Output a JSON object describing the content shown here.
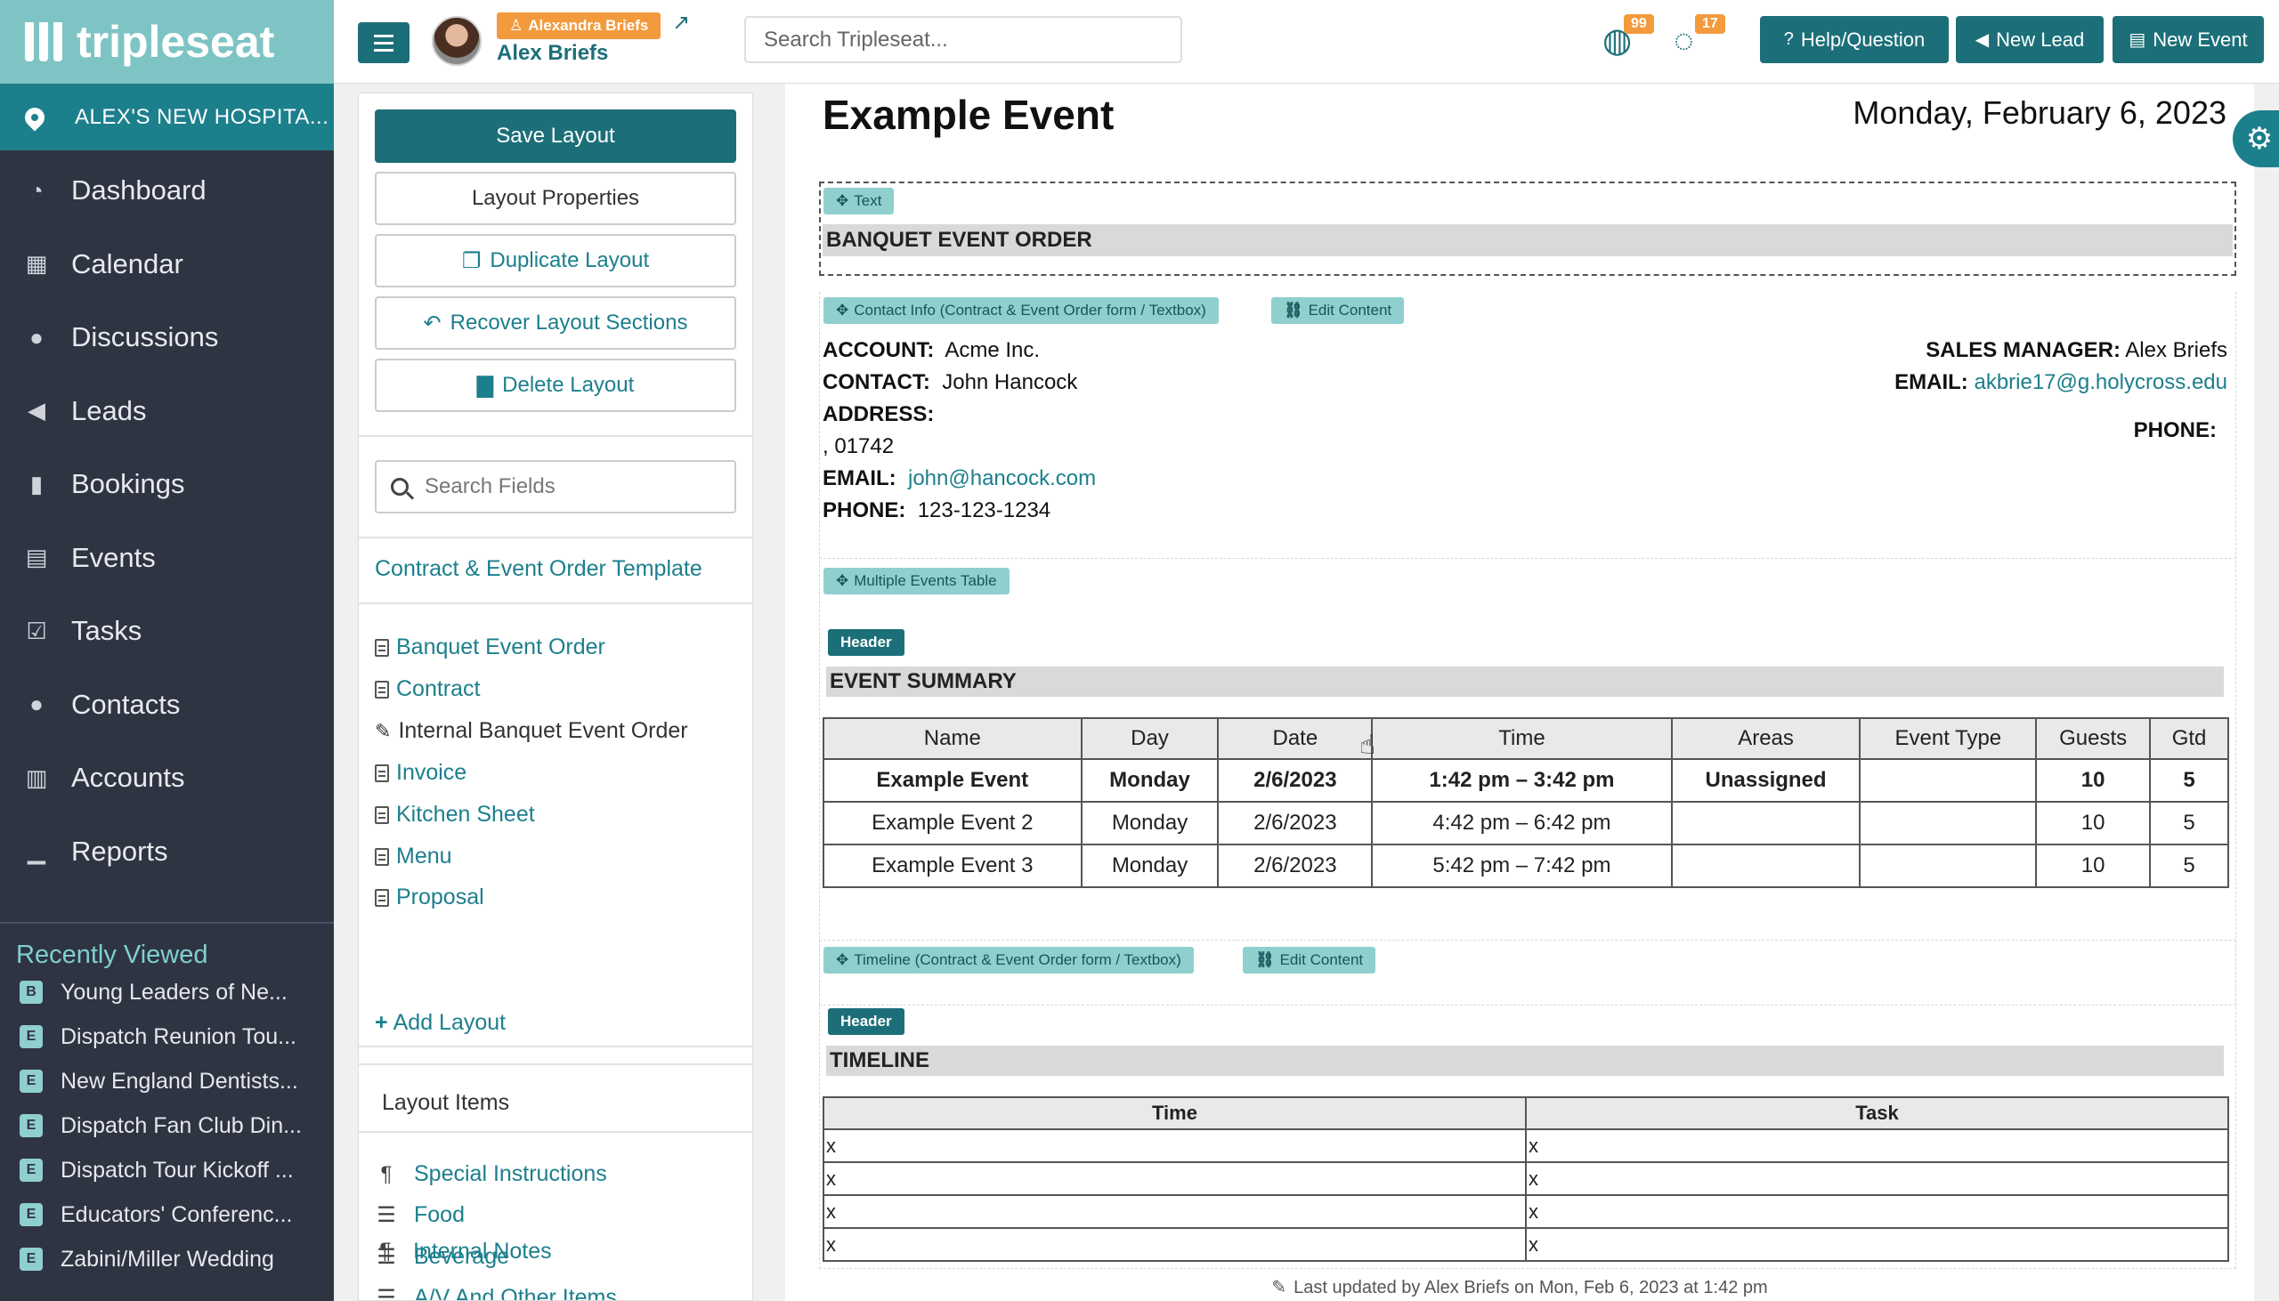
{
  "sidebar": {
    "logo_text": "tripleseat",
    "venue": "ALEX'S NEW HOSPITA...",
    "nav": [
      {
        "label": "Dashboard",
        "icon": "dashboard-icon"
      },
      {
        "label": "Calendar",
        "icon": "calendar-icon"
      },
      {
        "label": "Discussions",
        "icon": "chat-icon"
      },
      {
        "label": "Leads",
        "icon": "megaphone-icon"
      },
      {
        "label": "Bookings",
        "icon": "bookmark-icon"
      },
      {
        "label": "Events",
        "icon": "list-icon"
      },
      {
        "label": "Tasks",
        "icon": "checkbox-icon"
      },
      {
        "label": "Contacts",
        "icon": "users-icon"
      },
      {
        "label": "Accounts",
        "icon": "building-icon"
      },
      {
        "label": "Reports",
        "icon": "bar-chart-icon"
      }
    ],
    "recent_title": "Recently Viewed",
    "recent": [
      {
        "badge": "B",
        "label": "Young Leaders of Ne..."
      },
      {
        "badge": "E",
        "label": "Dispatch Reunion Tou..."
      },
      {
        "badge": "E",
        "label": "New England Dentists..."
      },
      {
        "badge": "E",
        "label": "Dispatch Fan Club Din..."
      },
      {
        "badge": "E",
        "label": "Dispatch Tour Kickoff ..."
      },
      {
        "badge": "E",
        "label": "Educators' Conferenc..."
      },
      {
        "badge": "E",
        "label": "Zabini/Miller Wedding"
      }
    ]
  },
  "topbar": {
    "impersonating": "Alexandra Briefs",
    "user_name": "Alex Briefs",
    "search_placeholder": "Search Tripleseat...",
    "globe_count": "99",
    "chat_count": "17",
    "help_label": "Help/Question",
    "new_lead_label": "New Lead",
    "new_event_label": "New Event"
  },
  "panel": {
    "save_layout": "Save Layout",
    "layout_properties": "Layout Properties",
    "duplicate_layout": "Duplicate Layout",
    "recover_sections": "Recover Layout Sections",
    "delete_layout": "Delete Layout",
    "search_fields_placeholder": "Search Fields",
    "template": "Contract & Event Order Template",
    "layouts": [
      {
        "label": "Banquet Event Order",
        "active": false
      },
      {
        "label": "Contract",
        "active": false
      },
      {
        "label": "Internal Banquet Event Order",
        "active": true
      },
      {
        "label": "Invoice",
        "active": false
      },
      {
        "label": "Kitchen Sheet",
        "active": false
      },
      {
        "label": "Menu",
        "active": false
      },
      {
        "label": "Proposal",
        "active": false
      }
    ],
    "add_layout": "Add Layout",
    "layout_items_title": "Layout Items",
    "layout_items": [
      {
        "label": "Special Instructions",
        "icon": "paragraph-icon"
      },
      {
        "label": "Food",
        "icon": "list-icon"
      },
      {
        "label": "Beverage",
        "icon": "list-icon"
      },
      {
        "label": "A/V And Other Items",
        "icon": "list-icon"
      },
      {
        "label": "Internal Notes",
        "icon": "paragraph-icon"
      }
    ]
  },
  "document": {
    "title": "Example Event",
    "date": "Monday, February 6, 2023",
    "text_tag": "Text",
    "banquet_header": "BANQUET EVENT ORDER",
    "contact_tag": "Contact Info (Contract & Event Order form / Textbox)",
    "edit_content": "Edit Content",
    "contact": {
      "account_label": "ACCOUNT:",
      "account": "Acme Inc.",
      "contact_label": "CONTACT:",
      "contact": "John Hancock",
      "address_label": "ADDRESS:",
      "address_line": ", 01742",
      "email_label": "EMAIL:",
      "email": "john@hancock.com",
      "phone_label": "PHONE:",
      "phone": "123-123-1234",
      "sales_manager_label": "SALES MANAGER:",
      "sales_manager": "Alex Briefs",
      "sm_email_label": "EMAIL:",
      "sm_email": "akbrie17@g.holycross.edu",
      "sm_phone_label": "PHONE:"
    },
    "multi_tag": "Multiple Events Table",
    "header_tag": "Header",
    "summary_header": "EVENT SUMMARY",
    "events_table": {
      "columns": [
        "Name",
        "Day",
        "Date",
        "Time",
        "Areas",
        "Event Type",
        "Guests",
        "Gtd"
      ],
      "rows": [
        [
          "Example Event",
          "Monday",
          "2/6/2023",
          "1:42 pm – 3:42 pm",
          "Unassigned",
          "",
          "10",
          "5"
        ],
        [
          "Example Event 2",
          "Monday",
          "2/6/2023",
          "4:42 pm – 6:42 pm",
          "",
          "",
          "10",
          "5"
        ],
        [
          "Example Event 3",
          "Monday",
          "2/6/2023",
          "5:42 pm – 7:42 pm",
          "",
          "",
          "10",
          "5"
        ]
      ]
    },
    "timeline_tag": "Timeline (Contract & Event Order form / Textbox)",
    "timeline_header": "TIMELINE",
    "timeline_table": {
      "columns": [
        "Time",
        "Task"
      ],
      "rows": [
        [
          "x",
          "x"
        ],
        [
          "x",
          "x"
        ],
        [
          "x",
          "x"
        ],
        [
          "x",
          "x"
        ]
      ]
    },
    "last_updated": "Last updated by Alex Briefs on Mon, Feb 6, 2023 at 1:42 pm"
  }
}
